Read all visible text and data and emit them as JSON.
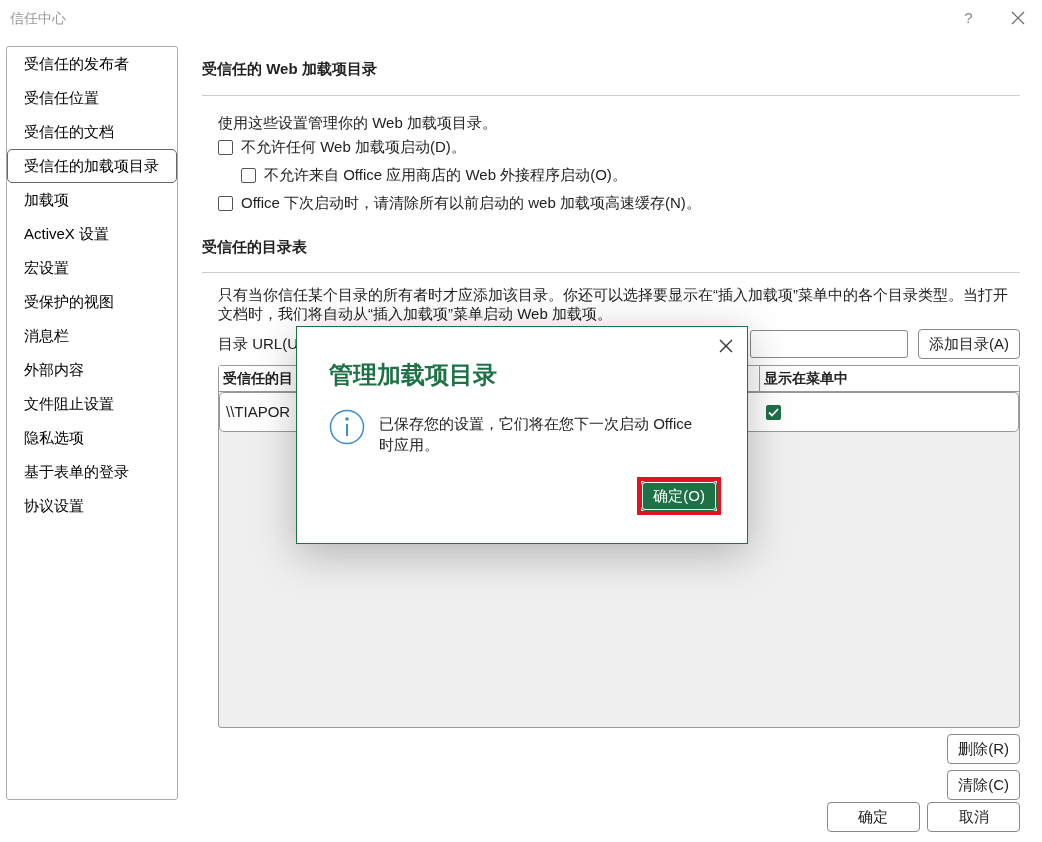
{
  "window": {
    "title": "信任中心",
    "help": "?"
  },
  "sidebar": {
    "items": [
      {
        "label": "受信任的发布者",
        "selected": false
      },
      {
        "label": "受信任位置",
        "selected": false
      },
      {
        "label": "受信任的文档",
        "selected": false
      },
      {
        "label": "受信任的加载项目录",
        "selected": true
      },
      {
        "label": "加载项",
        "selected": false
      },
      {
        "label": "ActiveX 设置",
        "selected": false
      },
      {
        "label": "宏设置",
        "selected": false
      },
      {
        "label": "受保护的视图",
        "selected": false
      },
      {
        "label": "消息栏",
        "selected": false
      },
      {
        "label": "外部内容",
        "selected": false
      },
      {
        "label": "文件阻止设置",
        "selected": false
      },
      {
        "label": "隐私选项",
        "selected": false
      },
      {
        "label": "基于表单的登录",
        "selected": false
      },
      {
        "label": "协议设置",
        "selected": false
      }
    ]
  },
  "section1": {
    "title": "受信任的 Web 加载项目录",
    "description": "使用这些设置管理你的 Web 加载项目录。",
    "options": [
      {
        "label": "不允许任何 Web 加载项启动(D)。",
        "checked": false,
        "indented": false
      },
      {
        "label": "不允许来自 Office 应用商店的 Web 外接程序启动(O)。",
        "checked": false,
        "indented": true
      },
      {
        "label": "Office 下次启动时，请清除所有以前启动的 web 加载项高速缓存(N)。",
        "checked": false,
        "indented": false
      }
    ]
  },
  "section2": {
    "title": "受信任的目录表",
    "description": "只有当你信任某个目录的所有者时才应添加该目录。你还可以选择要显示在“插入加载项”菜单中的各个目录类型。当打开",
    "description_line2": "文档时，我们将自动从“插入加载项”菜单启动 Web 加载项。",
    "url_label": "目录 URL(U",
    "add_button": "添加目录(A)",
    "table": {
      "columns": [
        "受信任的目",
        "显示在菜单中"
      ],
      "rows": [
        {
          "column_1": "\\\\TIAPOR",
          "show_in_menu": true
        }
      ]
    },
    "remove_button": "删除(R)",
    "clear_button": "清除(C)"
  },
  "footer": {
    "buttons": [
      "确定",
      "取消"
    ]
  },
  "message_dialog": {
    "title": "管理加载项目录",
    "message": "已保存您的设置，它们将在您下一次启动 Office 时应用。",
    "ok_button": "确定(O)",
    "ok_highlighted": true
  }
}
